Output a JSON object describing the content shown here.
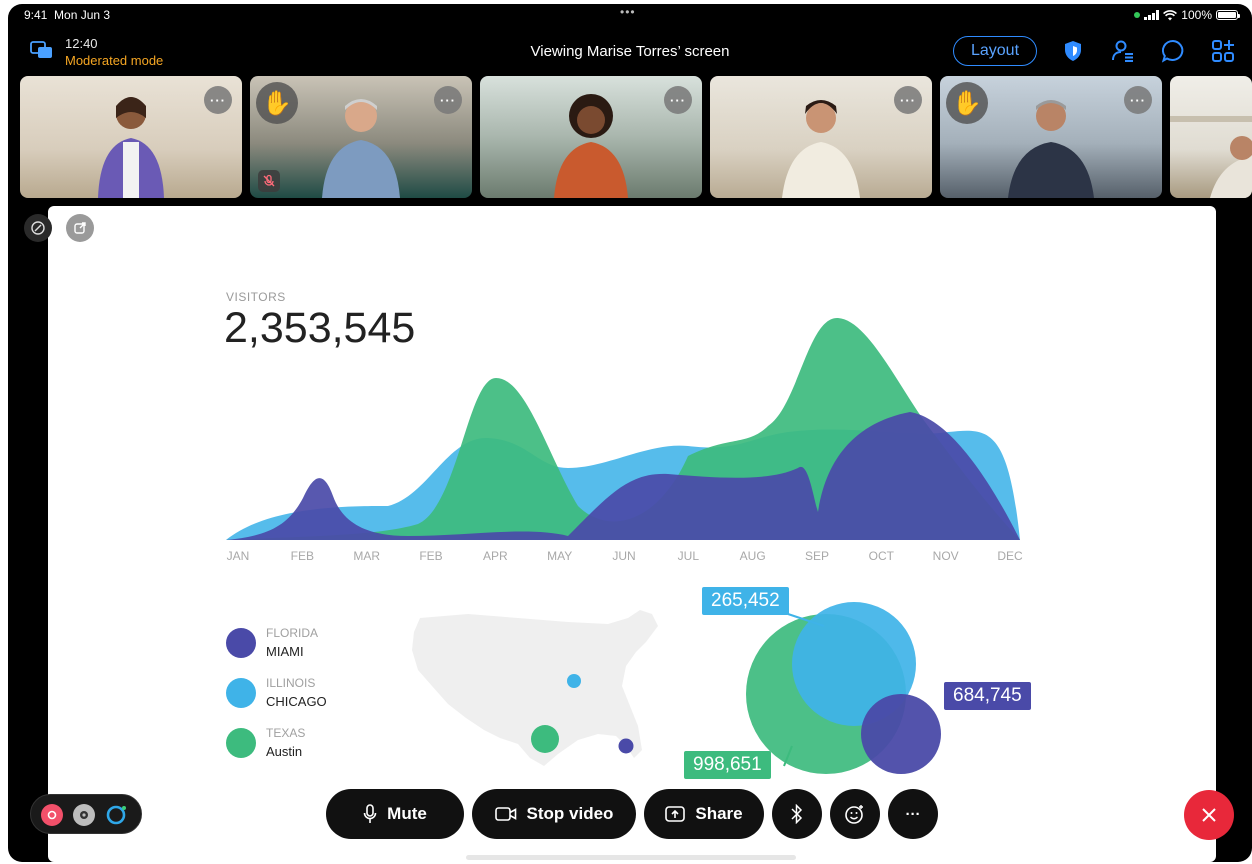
{
  "status_bar": {
    "time": "9:41",
    "date": "Mon Jun 3",
    "dots": "•••",
    "battery": "100%"
  },
  "header": {
    "meeting_time": "12:40",
    "mode": "Moderated mode",
    "title": "Viewing Marise Torres’ screen",
    "layout_label": "Layout",
    "colors": {
      "accent": "#2f8bff",
      "mode": "#f5a623"
    }
  },
  "participants": [
    {
      "more": "···",
      "hand_raised": false,
      "muted": false
    },
    {
      "more": "···",
      "hand_raised": true,
      "muted": true
    },
    {
      "more": "···",
      "hand_raised": false,
      "muted": false
    },
    {
      "more": "···",
      "hand_raised": false,
      "muted": false
    },
    {
      "more": "···",
      "hand_raised": true,
      "muted": false
    },
    {
      "more": "",
      "hand_raised": false,
      "muted": false
    }
  ],
  "shared_screen": {
    "visitors_label": "VISITORS",
    "visitors_value": "2,353,545",
    "months": [
      "JAN",
      "FEB",
      "MAR",
      "FEB",
      "APR",
      "MAY",
      "JUN",
      "JUL",
      "AUG",
      "SEP",
      "OCT",
      "NOV",
      "DEC"
    ],
    "legend": [
      {
        "state": "FLORIDA",
        "city": "MIAMI",
        "color": "#4a4aa8"
      },
      {
        "state": "ILLINOIS",
        "city": "CHICAGO",
        "color": "#3fb3e8"
      },
      {
        "state": "TEXAS",
        "city": "Austin",
        "color": "#3dbb7e"
      }
    ],
    "bubbles": [
      {
        "label": "265,452",
        "color": "#3fb3e8"
      },
      {
        "label": "684,745",
        "color": "#4a4aa8"
      },
      {
        "label": "998,651",
        "color": "#3dbb7e"
      }
    ]
  },
  "toolbar": {
    "mute_label": "Mute",
    "stop_video_label": "Stop video",
    "share_label": "Share",
    "more_label": "···"
  }
}
